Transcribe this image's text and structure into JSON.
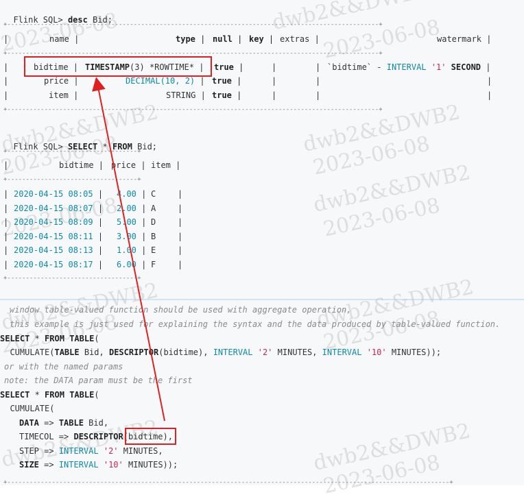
{
  "watermark": {
    "line1": "dwb2&&DWB2",
    "line2": "2023-06-08"
  },
  "desc": {
    "prompt": "Flink SQL>",
    "cmd_kw": "desc",
    "cmd_rest": " Bid;",
    "border": "+----------------------------------------------------------------------------------------------------+",
    "headers": [
      "name",
      "type",
      "null",
      "key",
      "extras",
      "watermark"
    ],
    "rows": [
      {
        "name": "bidtime",
        "type_kw": "TIMESTAMP",
        "type_paren": "(3)",
        "type_extra": "*ROWTIME*",
        "null": "true",
        "key": "",
        "extras": "",
        "wm_col": "`bidtime`",
        "wm_op": " - ",
        "wm_kw": "INTERVAL",
        "wm_str": "'1'",
        "wm_unit": "SECOND"
      },
      {
        "name": "price",
        "type_kw": "DECIMAL",
        "type_paren": "(10, 2)",
        "null": "true"
      },
      {
        "name": "item",
        "type_kw": "STRING",
        "null": "true"
      }
    ]
  },
  "select": {
    "prompt": "Flink SQL>",
    "kw1": "SELECT",
    "mid": " * ",
    "kw2": "FROM",
    "rest": " Bid;",
    "border": "+-----------------------------------+",
    "headers": [
      "bidtime",
      "price",
      "item"
    ],
    "rows": [
      {
        "time": "2020-04-15 08:05",
        "price": "4.00",
        "item": "C"
      },
      {
        "time": "2020-04-15 08:07",
        "price": "2.00",
        "item": "A"
      },
      {
        "time": "2020-04-15 08:09",
        "price": "5.00",
        "item": "D"
      },
      {
        "time": "2020-04-15 08:11",
        "price": "3.00",
        "item": "B"
      },
      {
        "time": "2020-04-15 08:13",
        "price": "1.00",
        "item": "E"
      },
      {
        "time": "2020-04-15 08:17",
        "price": "6.00",
        "item": "F"
      }
    ]
  },
  "code": {
    "c1": "window table-valued function should be used with aggregate operation,",
    "c2": "this example is just used for explaining the syntax and the data produced by table-valued function.",
    "select_kw": "SELECT",
    "star": " * ",
    "from_kw": "FROM",
    "table_kw": "TABLE",
    "paren": "(",
    "cumulate_a": "  CUMULATE(",
    "table_kw2": "TABLE",
    "bid": " Bid, ",
    "descriptor_kw": "DESCRIPTOR",
    "bidtime_arg": "(bidtime), ",
    "interval1": "INTERVAL",
    "two": "'2'",
    "minutes1": " MINUTES, ",
    "interval2": "INTERVAL",
    "ten": "'10'",
    "minutes2": " MINUTES));",
    "c3": "or with the named params",
    "c4": "note: the DATA param must be the first",
    "cumulate_b": "  CUMULATE(",
    "data_kw": "DATA",
    "arrow": " => ",
    "table_kw3": "TABLE",
    "bid2": " Bid,",
    "timecol": "TIMECOL",
    "descriptor_kw2": "DESCRIPTOR",
    "bidtime_named": "(bidtime)",
    "comma": ",",
    "step": "STEP",
    "step_int": "INTERVAL",
    "step_val": "'2'",
    "step_unit": " MINUTES,",
    "size_kw": "SIZE",
    "size_int": "INTERVAL",
    "size_val": "'10'",
    "size_unit": " MINUTES));",
    "bottom_border": "+-----------------------------------------------------------------------------------------------------------------------+"
  }
}
